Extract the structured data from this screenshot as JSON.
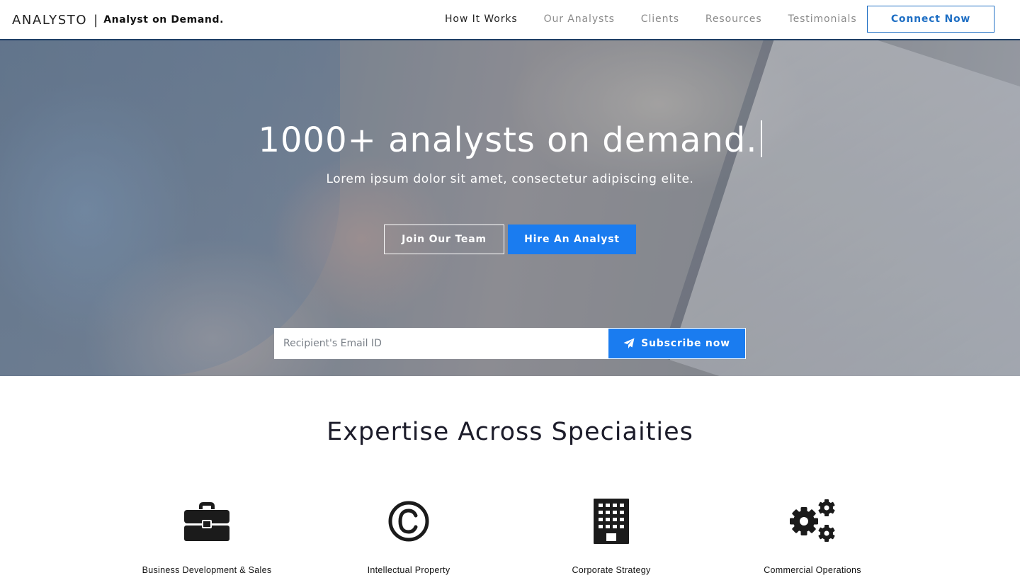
{
  "brand": {
    "name": "ANALYSTO",
    "separator": "|",
    "tagline": "Analyst on Demand."
  },
  "nav": {
    "items": [
      {
        "label": "How It Works",
        "active": true
      },
      {
        "label": "Our Analysts",
        "active": false
      },
      {
        "label": "Clients",
        "active": false
      },
      {
        "label": "Resources",
        "active": false
      },
      {
        "label": "Testimonials",
        "active": false
      }
    ],
    "cta_label": "Connect Now"
  },
  "hero": {
    "title": "1000+ analysts on demand.",
    "subtitle": "Lorem ipsum dolor sit amet, consectetur adipiscing elite.",
    "join_label": "Join Our Team",
    "hire_label": "Hire An Analyst",
    "email_placeholder": "Recipient's Email ID",
    "subscribe_label": "Subscribe now"
  },
  "expertise": {
    "title": "Expertise Across Speciaities",
    "items": [
      {
        "label": "Business Development & Sales",
        "icon": "briefcase-icon"
      },
      {
        "label": "Intellectual Property",
        "icon": "copyright-icon"
      },
      {
        "label": "Corporate Strategy",
        "icon": "building-icon"
      },
      {
        "label": "Commercial Operations",
        "icon": "gears-icon"
      }
    ]
  },
  "colors": {
    "accent": "#1a7cf0",
    "nav_border": "#1f3f66",
    "connect_button": "#1f6fc4",
    "text_dark": "#1c1c2a"
  }
}
